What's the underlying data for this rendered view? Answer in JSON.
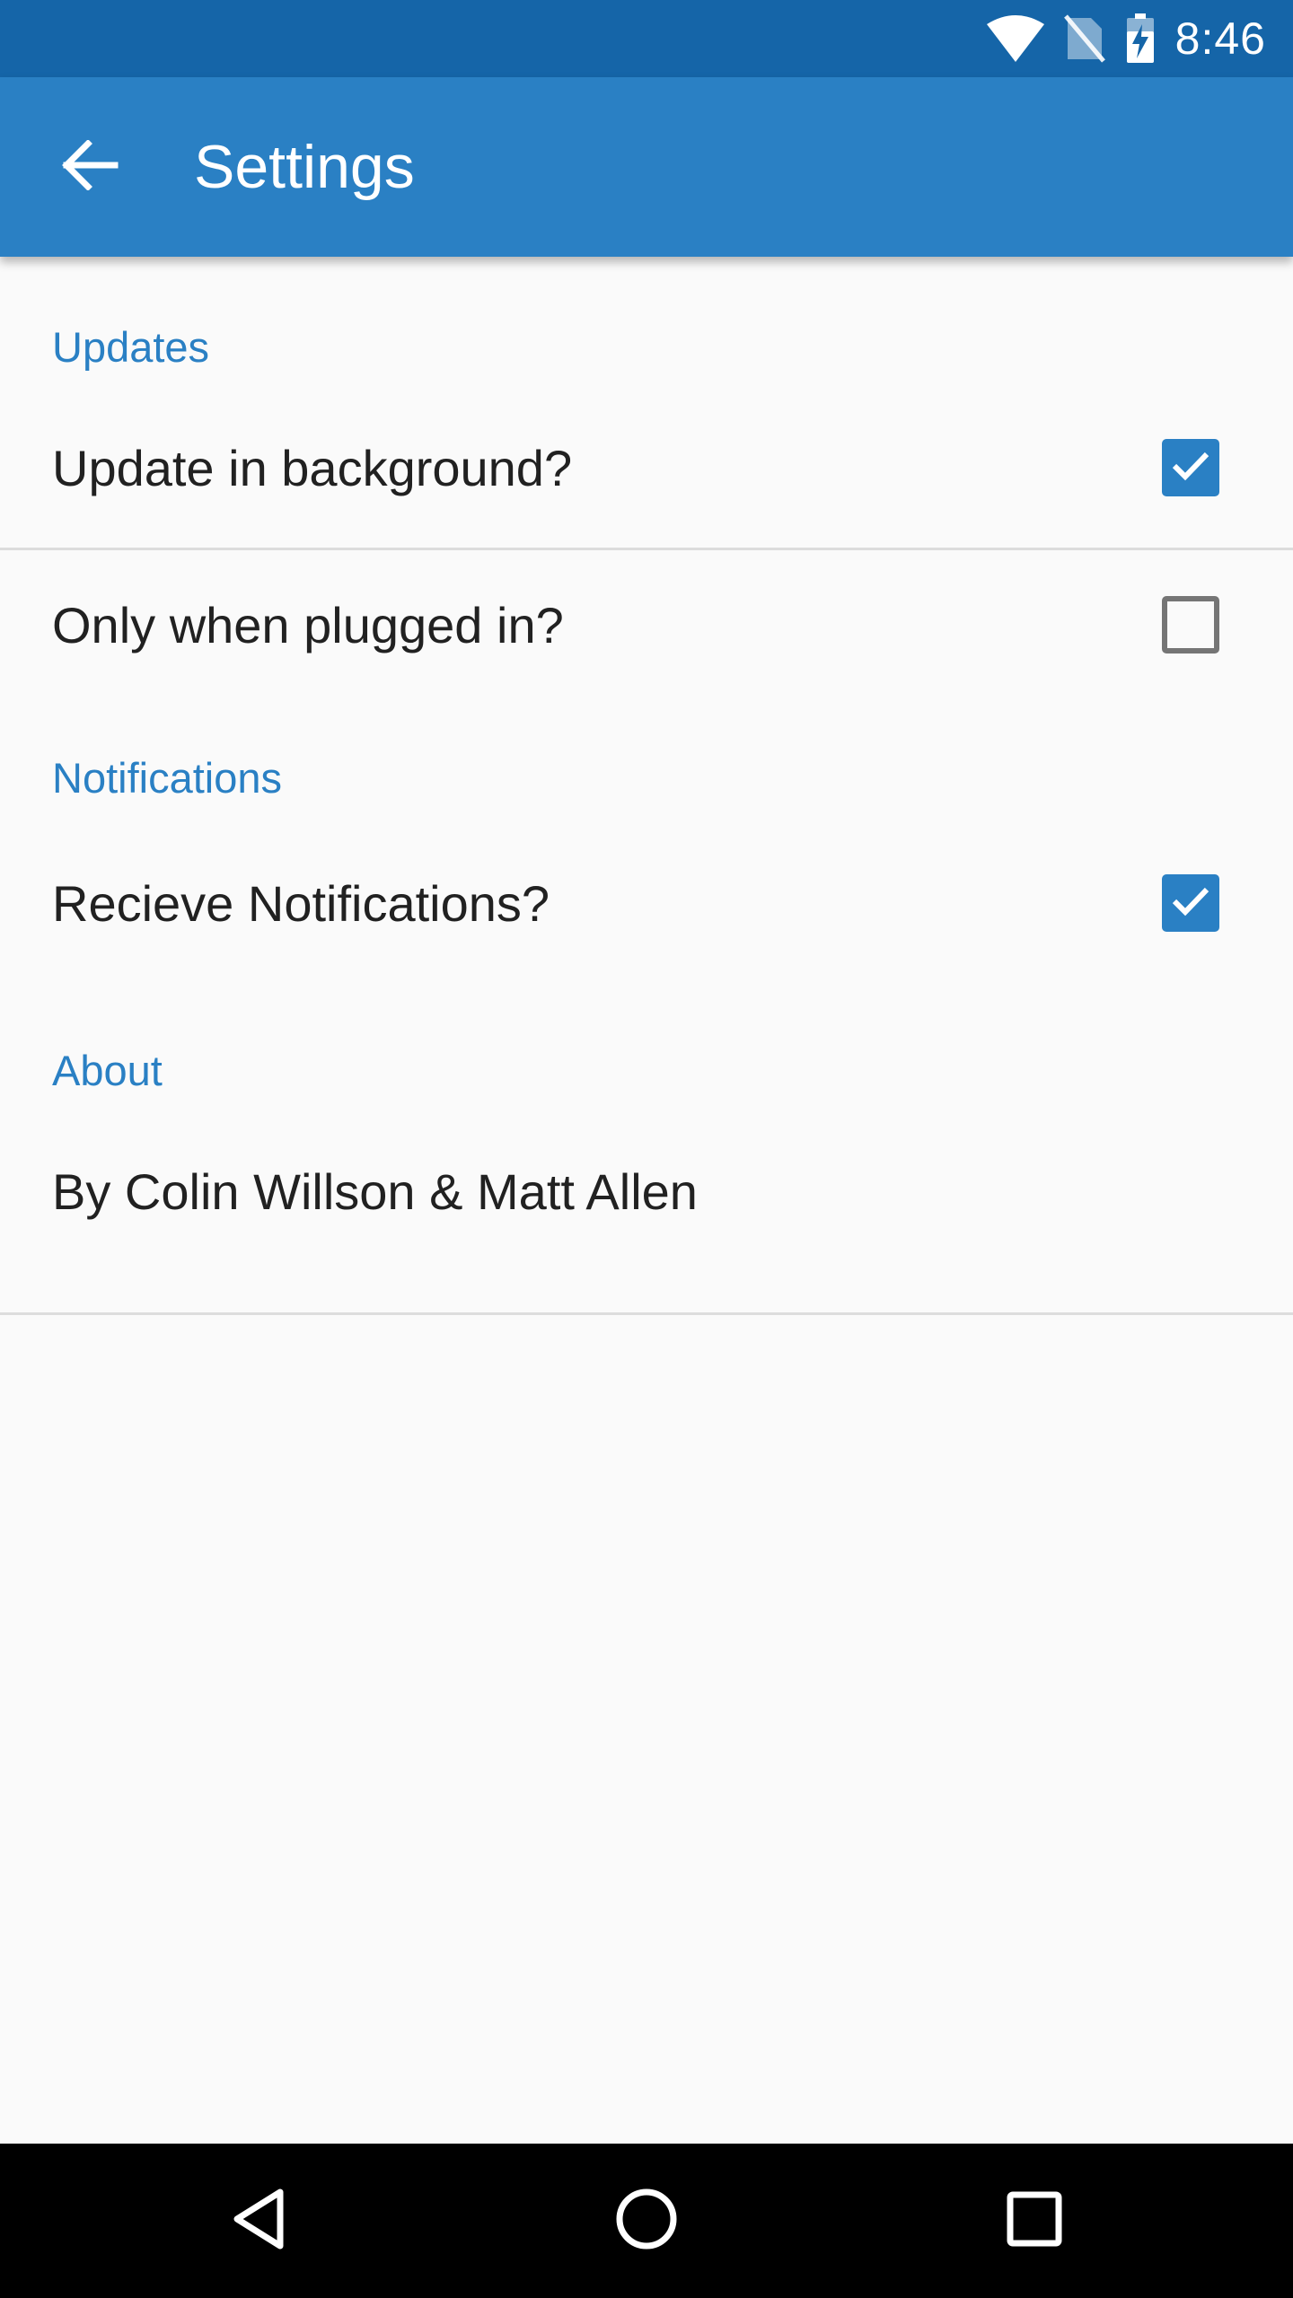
{
  "status_bar": {
    "time": "8:46",
    "icons": [
      "wifi-icon",
      "no-sim-icon",
      "battery-charging-icon"
    ]
  },
  "app_bar": {
    "title": "Settings",
    "back_icon": "arrow-back-icon"
  },
  "sections": {
    "updates": {
      "header": "Updates",
      "items": [
        {
          "label": "Update in background?",
          "checked": true
        },
        {
          "label": "Only when plugged in?",
          "checked": false
        }
      ]
    },
    "notifications": {
      "header": "Notifications",
      "items": [
        {
          "label": "Recieve Notifications?",
          "checked": true
        }
      ]
    },
    "about": {
      "header": "About",
      "text": "By Colin Willson & Matt Allen"
    }
  },
  "nav_bar": {
    "icons": [
      "back-triangle-icon",
      "home-circle-icon",
      "recents-square-icon"
    ]
  },
  "colors": {
    "status_bar": "#1565a8",
    "app_bar": "#2a80c4",
    "accent": "#2a80c4",
    "background": "#fafafa"
  }
}
